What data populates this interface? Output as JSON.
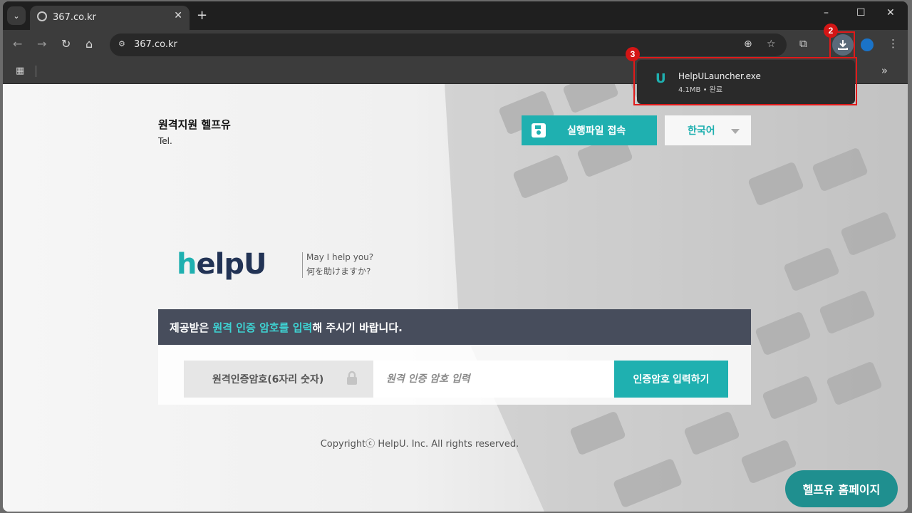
{
  "browser": {
    "tab_title": "367.co.kr",
    "url": "367.co.kr",
    "new_tab_symbol": "+",
    "tab_close_symbol": "✕",
    "window_controls": [
      "–",
      "☐",
      "✕"
    ],
    "bookmarks_more_symbol": "»"
  },
  "annotations": {
    "download_button_marker": "2",
    "download_popup_marker": "3"
  },
  "download": {
    "file_name": "HelpULauncher.exe",
    "meta": "4.1MB • 완료",
    "icon": "helpu-file-icon"
  },
  "page": {
    "brand_name": "원격지원 헬프유",
    "tel_label": "Tel.",
    "exec_button_label": "실행파일 접속",
    "language_label": "한국어",
    "logo_text": "helpU",
    "logo_h": "h",
    "logo_rest": "elpU",
    "logo_prefix": "U",
    "tagline_en": "May I help you?",
    "tagline_jp": "何を助けますか?",
    "instruction_prefix": "제공받은 ",
    "instruction_highlight": "원격 인증 암호를 입력",
    "instruction_suffix": "해 주시기 바랍니다.",
    "password_label": "원격인증암호(6자리 숫자)",
    "password_placeholder": "원격 인증 암호 입력",
    "password_value": "",
    "submit_label": "인증암호 입력하기",
    "copyright": "Copyrightⓒ HelpU. Inc. All rights reserved.",
    "home_button_label": "헬프유 홈페이지"
  },
  "colors": {
    "accent": "#1fb0b0",
    "instruction_bar": "#474d5c",
    "highlight": "#3ed3d3",
    "annotation_red": "#e01a1a"
  }
}
